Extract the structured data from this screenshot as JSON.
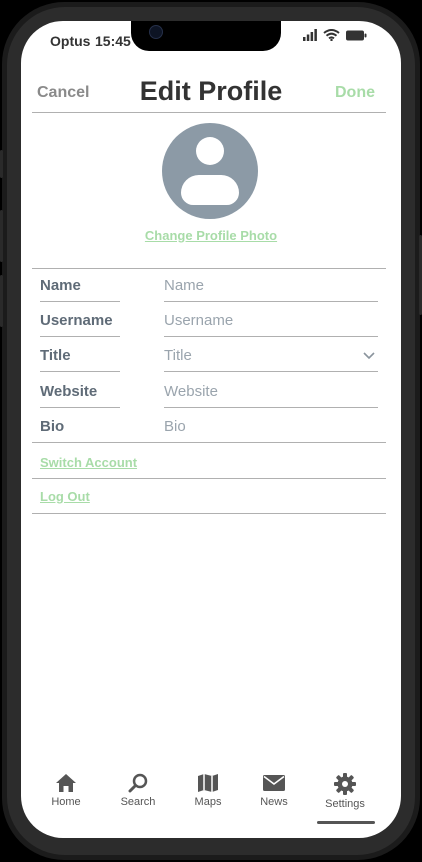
{
  "status_bar": {
    "carrier": "Optus",
    "time": "15:45"
  },
  "nav": {
    "cancel_label": "Cancel",
    "title": "Edit Profile",
    "done_label": "Done"
  },
  "profile": {
    "change_photo_label": "Change Profile Photo",
    "avatar_icon": "person-icon"
  },
  "fields": [
    {
      "label": "Name",
      "placeholder": "Name"
    },
    {
      "label": "Username",
      "placeholder": "Username"
    },
    {
      "label": "Title",
      "placeholder": "Title"
    },
    {
      "label": "Website",
      "placeholder": "Website"
    },
    {
      "label": "Bio",
      "placeholder": "Bio"
    }
  ],
  "links": {
    "switch_account": "Switch Account",
    "log_out": "Log Out"
  },
  "tabbar": {
    "items": [
      {
        "label": "Home",
        "icon": "home-icon"
      },
      {
        "label": "Search",
        "icon": "search-icon"
      },
      {
        "label": "Maps",
        "icon": "map-icon"
      },
      {
        "label": "News",
        "icon": "mail-icon"
      },
      {
        "label": "Settings",
        "icon": "gear-icon"
      }
    ],
    "active": "Settings"
  },
  "colors": {
    "accent": "#a8dca8",
    "avatar": "#8c9aa6",
    "text": "#333333"
  }
}
